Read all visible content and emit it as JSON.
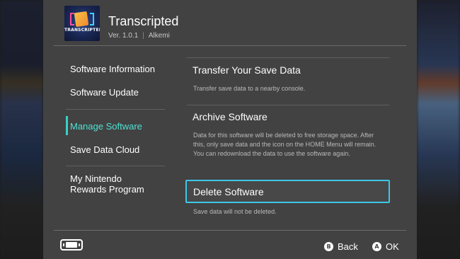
{
  "app": {
    "icon_text": "TRANSCRIPTED",
    "title": "Transcripted",
    "version": "Ver. 1.0.1",
    "publisher": "Alkemi"
  },
  "menu": {
    "items": [
      {
        "label": "Software Information"
      },
      {
        "label": "Software Update"
      },
      {
        "label": "Manage Software",
        "active": true
      },
      {
        "label": "Save Data Cloud"
      },
      {
        "label": "My Nintendo\nRewards Program"
      }
    ]
  },
  "options": [
    {
      "title": "Transfer Your Save Data",
      "desc": "Transfer save data to a nearby console."
    },
    {
      "title": "Archive Software",
      "desc": "Data for this software will be deleted to free storage space. After this, only save data and the icon on the HOME Menu will remain. You can redownload the data to use the software again."
    },
    {
      "title": "Delete Software",
      "desc": "Save data will not be deleted.",
      "selected": true
    }
  ],
  "footer": {
    "back_glyph": "B",
    "back_label": "Back",
    "ok_glyph": "A",
    "ok_label": "OK"
  },
  "colors": {
    "panel": "#424242",
    "accent_active": "#4fe0d2",
    "selection_border": "#3fc6e8"
  }
}
